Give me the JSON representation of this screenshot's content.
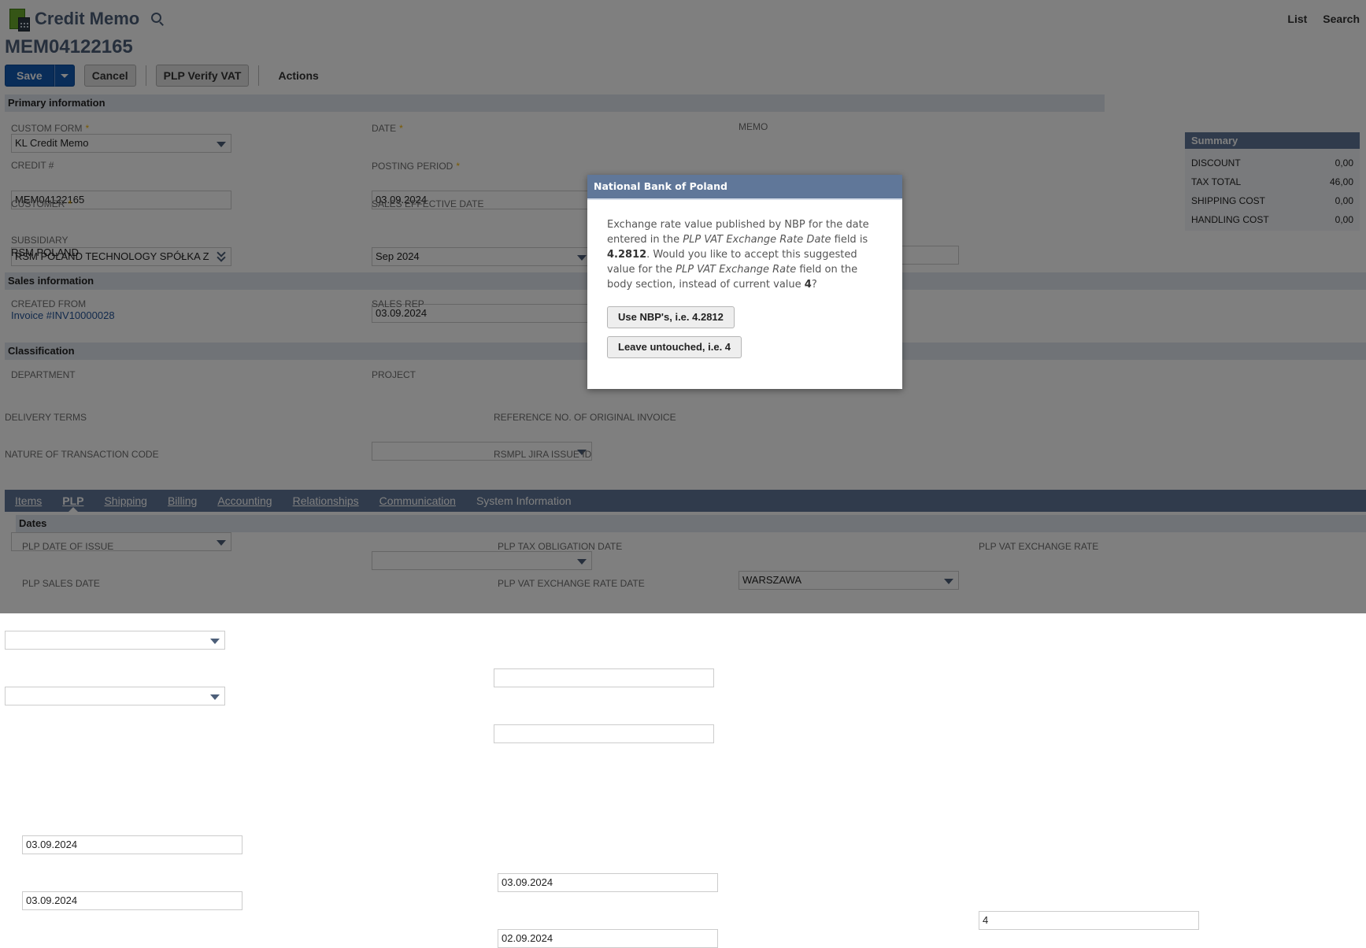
{
  "header": {
    "record_type": "Credit Memo",
    "record_id": "MEM04122165",
    "nav": {
      "list": "List",
      "search": "Search"
    }
  },
  "toolbar": {
    "save": "Save",
    "cancel": "Cancel",
    "plp_verify_vat": "PLP Verify VAT",
    "actions": "Actions"
  },
  "primary": {
    "title": "Primary information",
    "custom_form": {
      "label": "CUSTOM FORM",
      "value": "KL Credit Memo"
    },
    "credit_no": {
      "label": "CREDIT #",
      "value": "MEM04122165"
    },
    "customer": {
      "label": "CUSTOMER",
      "value": "RSM POLAND TECHNOLOGY SPÓŁKA Z"
    },
    "subsidiary": {
      "label": "SUBSIDIARY",
      "value": "RSM POLAND"
    },
    "date": {
      "label": "DATE",
      "value": "03.09.2024"
    },
    "posting_period": {
      "label": "POSTING PERIOD",
      "value": "Sep 2024"
    },
    "sales_effective_date": {
      "label": "SALES EFFECTIVE DATE",
      "value": "03.09.2024"
    },
    "memo": {
      "label": "MEMO",
      "value": ""
    }
  },
  "summary": {
    "title": "Summary",
    "rows": [
      {
        "label": "DISCOUNT",
        "value": "0,00"
      },
      {
        "label": "TAX TOTAL",
        "value": "46,00"
      },
      {
        "label": "SHIPPING COST",
        "value": "0,00"
      },
      {
        "label": "HANDLING COST",
        "value": "0,00"
      }
    ]
  },
  "sales": {
    "title": "Sales information",
    "created_from": {
      "label": "CREATED FROM",
      "value": "Invoice #INV10000028"
    },
    "sales_rep": {
      "label": "SALES REP",
      "value": ""
    }
  },
  "classification": {
    "title": "Classification",
    "department": {
      "label": "DEPARTMENT",
      "value": ""
    },
    "project": {
      "label": "PROJECT",
      "value": ""
    },
    "location": {
      "value": "WARSZAWA"
    },
    "delivery_terms": {
      "label": "DELIVERY TERMS",
      "value": ""
    },
    "nature_of_transaction": {
      "label": "NATURE OF TRANSACTION CODE",
      "value": ""
    },
    "ref_original_invoice": {
      "label": "REFERENCE NO. OF ORIGINAL INVOICE",
      "value": ""
    },
    "jira_issue": {
      "label": "RSMPL JIRA ISSUE ID",
      "value": ""
    }
  },
  "tabs": [
    {
      "label": "Items",
      "active": false
    },
    {
      "label": "PLP",
      "active": true
    },
    {
      "label": "Shipping",
      "active": false
    },
    {
      "label": "Billing",
      "active": false
    },
    {
      "label": "Accounting",
      "active": false
    },
    {
      "label": "Relationships",
      "active": false
    },
    {
      "label": "Communication",
      "active": false
    },
    {
      "label": "System Information",
      "active": false
    }
  ],
  "plp": {
    "dates_title": "Dates",
    "date_of_issue": {
      "label": "PLP DATE OF ISSUE",
      "value": "03.09.2024"
    },
    "sales_date": {
      "label": "PLP SALES DATE",
      "value": "03.09.2024"
    },
    "tax_obligation_date": {
      "label": "PLP TAX OBLIGATION DATE",
      "value": "03.09.2024"
    },
    "vat_exchange_rate_date": {
      "label": "PLP VAT EXCHANGE RATE DATE",
      "value": "02.09.2024"
    },
    "vat_exchange_rate": {
      "label": "PLP VAT EXCHANGE RATE",
      "value": "4"
    }
  },
  "dialog": {
    "title": "National Bank of Poland",
    "text_1": "Exchange rate value published by NBP for the date entered in the ",
    "field_1": "PLP VAT Exchange Rate Date",
    "text_2": " field is ",
    "suggested": "4.2812",
    "text_3": ". Would you like to accept this suggested value for the ",
    "field_2": "PLP VAT Exchange Rate",
    "text_4": " field on the body section, instead of current value ",
    "current": "4",
    "text_5": "?",
    "accept_button": "Use NBP's, i.e. 4.2812",
    "reject_button": "Leave untouched, i.e. 4"
  }
}
